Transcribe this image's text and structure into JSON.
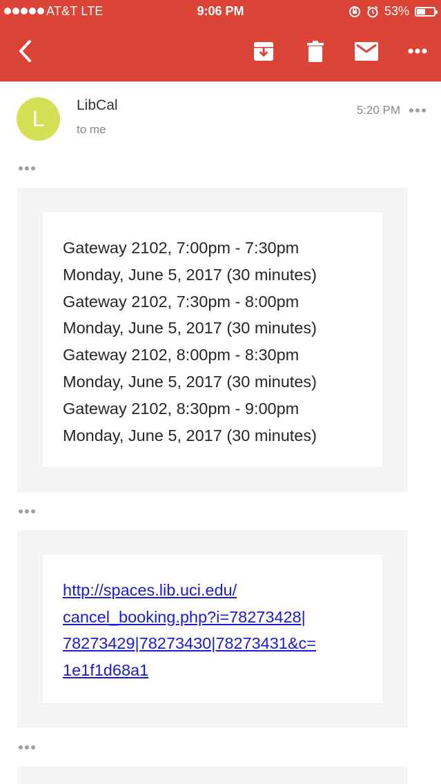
{
  "status_bar": {
    "carrier": "AT&T  LTE",
    "time": "9:06 PM",
    "battery_percent": "53%"
  },
  "toolbar": {
    "back_icon": "chevron-left-icon",
    "actions": [
      "archive-icon",
      "trash-icon",
      "mail-icon",
      "more-horizontal-icon"
    ]
  },
  "message": {
    "avatar_letter": "L",
    "sender": "LibCal",
    "recipient": "to me",
    "time": "5:20 PM",
    "bookings": [
      "Gateway 2102, 7:00pm - 7:30pm",
      "Monday, June 5, 2017 (30 minutes)",
      "Gateway 2102, 7:30pm - 8:00pm",
      "Monday, June 5, 2017 (30 minutes)",
      "Gateway 2102, 8:00pm - 8:30pm",
      "Monday, June 5, 2017 (30 minutes)",
      "Gateway 2102, 8:30pm - 9:00pm",
      "Monday, June 5, 2017 (30 minutes)"
    ],
    "cancel_link_lines": [
      "http://spaces.lib.uci.edu/",
      "cancel_booking.php?i=78273428|",
      "78273429|78273430|78273431&c=",
      "1e1f1d68a1"
    ]
  },
  "colors": {
    "header_red": "#db4437",
    "avatar_lime": "#d4e157",
    "link_blue": "#1a1ad6",
    "block_gray": "#f5f5f5"
  }
}
